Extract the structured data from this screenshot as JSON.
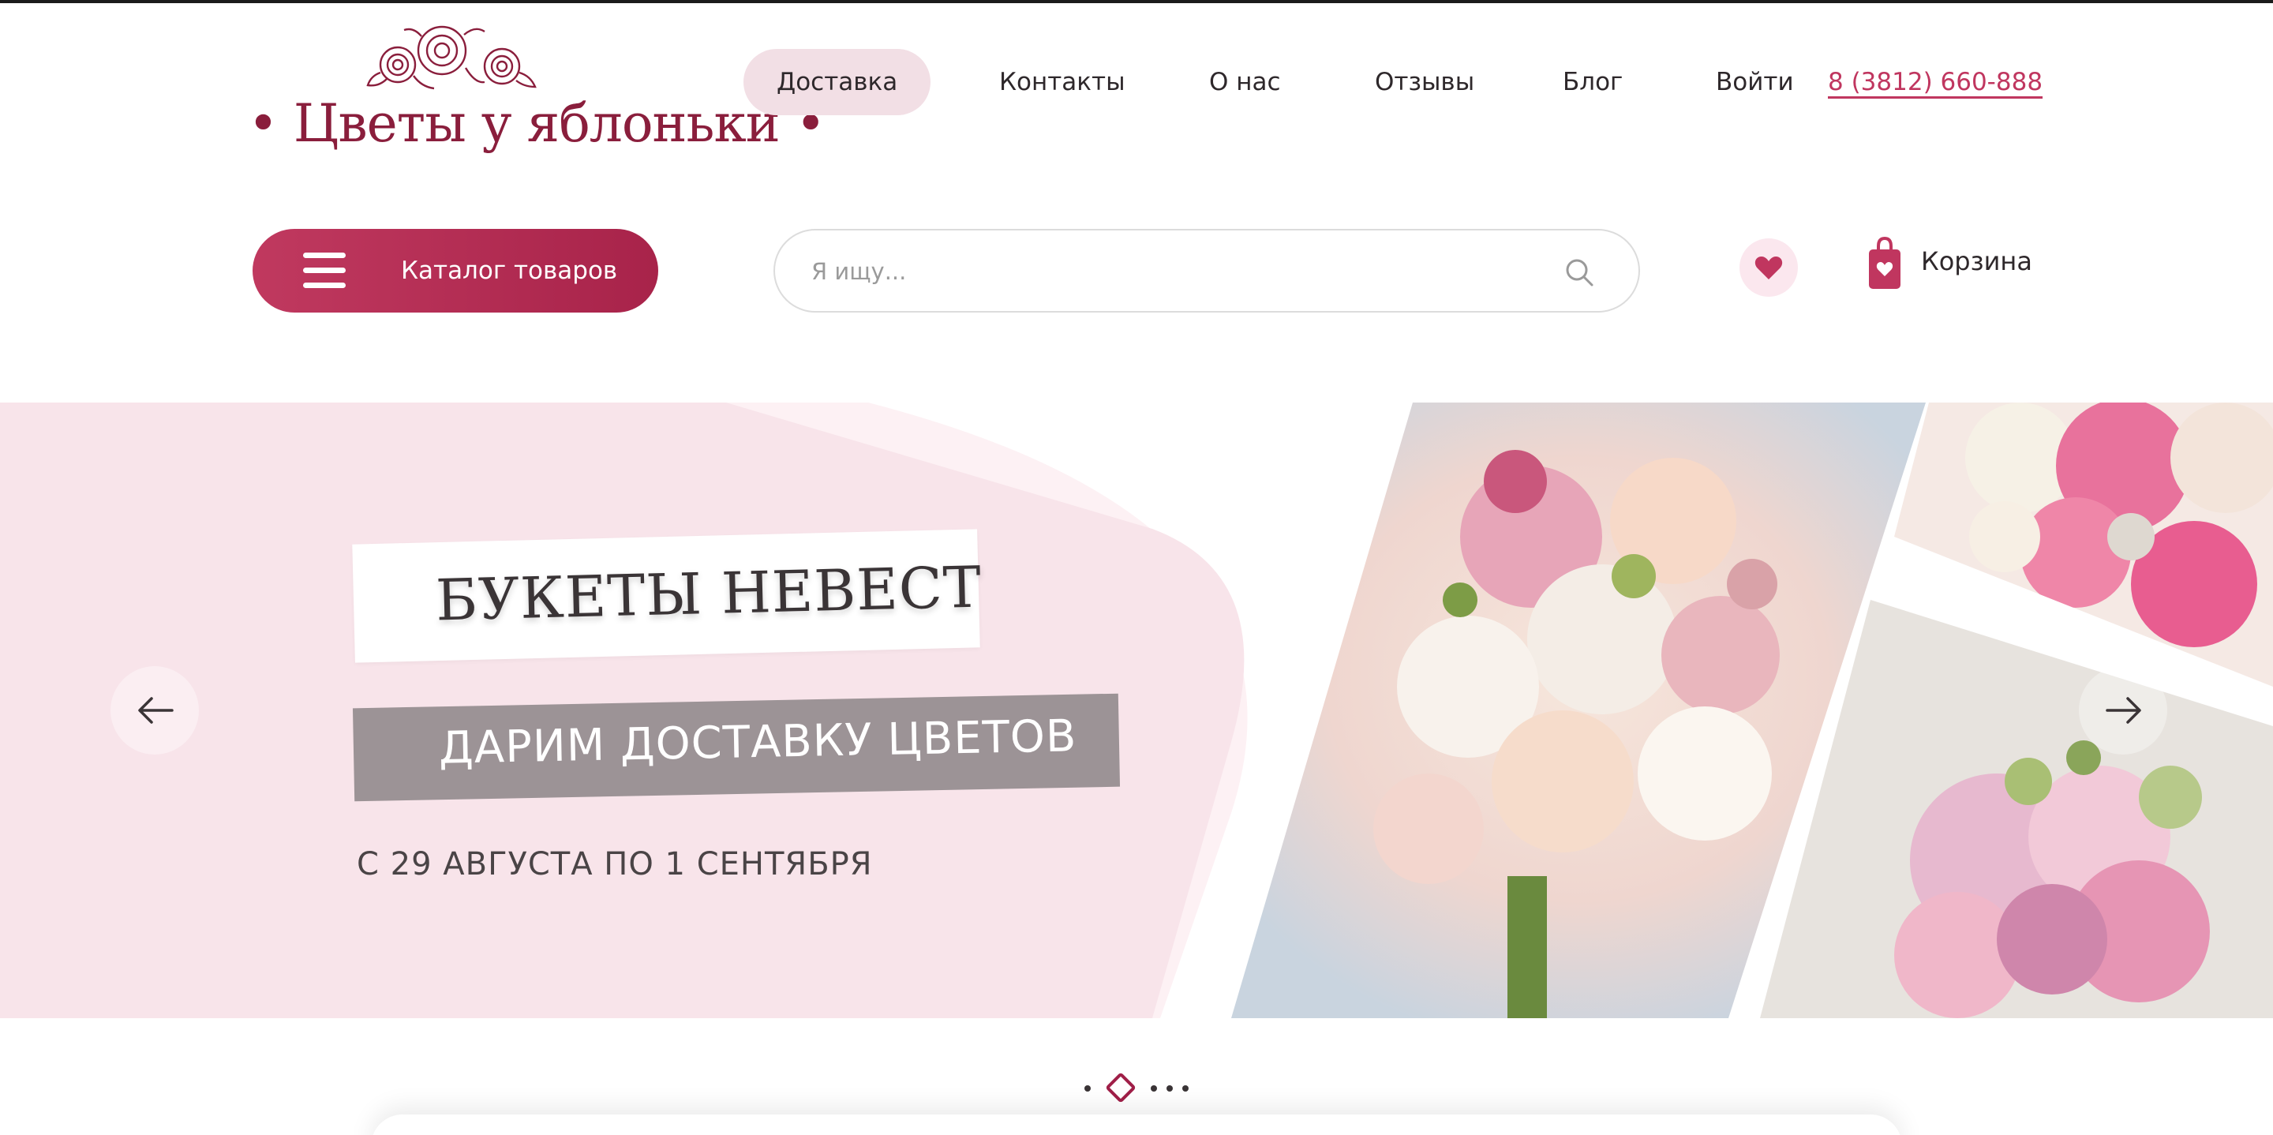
{
  "brand": {
    "logo_text": "• Цветы у яблоньки •",
    "accent": "#c0365f",
    "dark_accent": "#8a1e3c"
  },
  "nav": {
    "items": [
      {
        "label": "Доставка",
        "active": true
      },
      {
        "label": "Контакты",
        "active": false
      },
      {
        "label": "О нас",
        "active": false
      },
      {
        "label": "Отзывы",
        "active": false
      },
      {
        "label": "Блог",
        "active": false
      },
      {
        "label": "Войти",
        "active": false
      }
    ],
    "phone": "8 (3812) 660-888"
  },
  "toolbar": {
    "catalog_label": "Каталог товаров",
    "search_placeholder": "Я ищу...",
    "cart_label": "Корзина",
    "icons": [
      "menu-icon",
      "search-icon",
      "heart-icon",
      "shopping-bag-icon"
    ]
  },
  "hero": {
    "title": "БУКЕТЫ НЕВЕСТ",
    "subtitle": "ДАРИМ ДОСТАВКУ ЦВЕТОВ",
    "dates": "С 29 АВГУСТА ПО 1 СЕНТЯБРЯ",
    "background_color": "#f8e4ea",
    "banner_grey_color": "#9c9396"
  },
  "pager": {
    "total": 5,
    "current": 2
  }
}
